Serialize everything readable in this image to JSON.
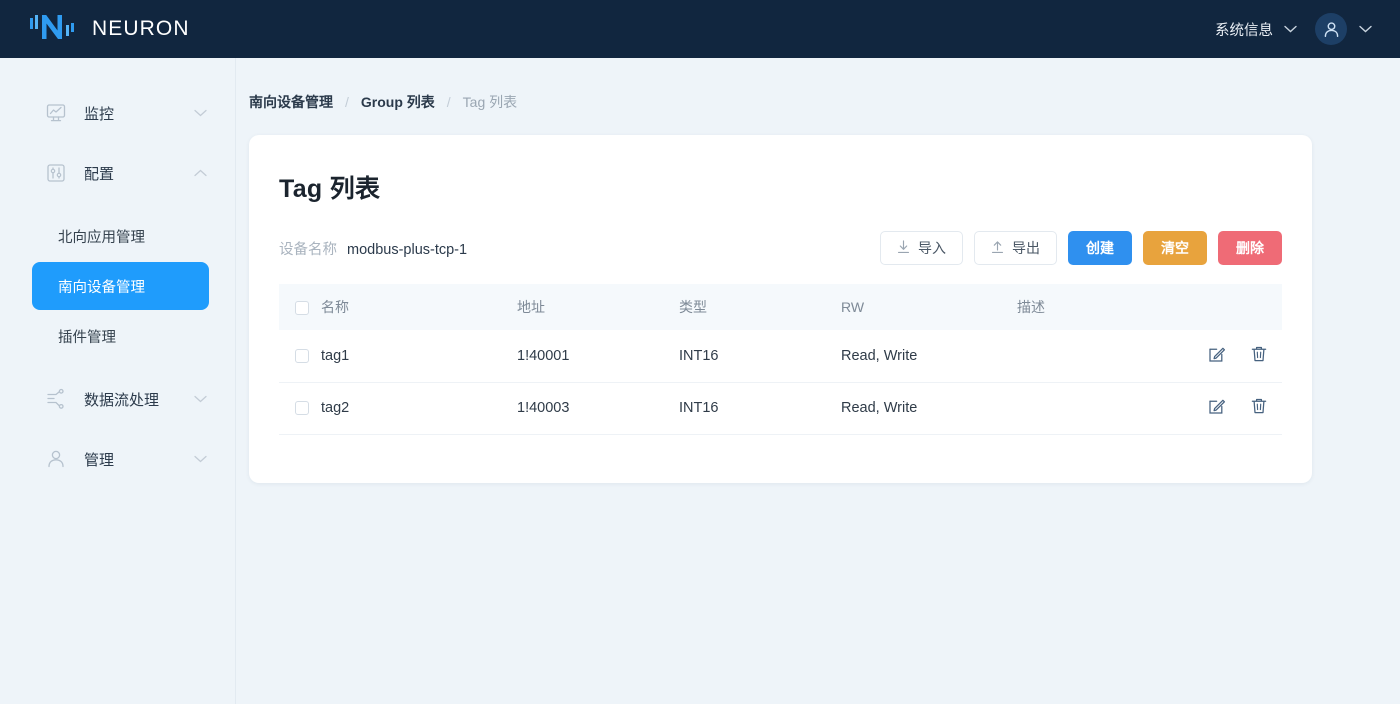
{
  "header": {
    "brand_name": "NEURON",
    "logo_icon": "neuron-logo-icon",
    "system_info_label": "系统信息",
    "system_info_chevron_icon": "chevron-down-icon",
    "avatar_icon": "user-avatar-icon",
    "avatar_chevron_icon": "chevron-down-icon",
    "brand_bg": "#11263f",
    "accent": "#2f90ef"
  },
  "sidebar": {
    "groups": [
      {
        "label": "监控",
        "icon": "monitor-chart-icon",
        "chevron_icon": "chevron-down-icon",
        "expanded": false
      },
      {
        "label": "配置",
        "icon": "sliders-config-icon",
        "chevron_icon": "chevron-up-icon",
        "expanded": true
      },
      {
        "label": "数据流处理",
        "icon": "data-flow-icon",
        "chevron_icon": "chevron-down-icon",
        "expanded": false
      },
      {
        "label": "管理",
        "icon": "user-manage-icon",
        "chevron_icon": "chevron-down-icon",
        "expanded": false
      }
    ],
    "config_children": [
      {
        "label": "北向应用管理",
        "active": false
      },
      {
        "label": "南向设备管理",
        "active": true
      },
      {
        "label": "插件管理",
        "active": false
      }
    ],
    "active_color": "#1f9cfc"
  },
  "breadcrumb": {
    "items": [
      {
        "label": "南向设备管理",
        "current": false
      },
      {
        "label": "Group 列表",
        "current": false
      },
      {
        "label": "Tag 列表",
        "current": true
      }
    ],
    "separator": "/"
  },
  "card": {
    "title": "Tag 列表",
    "device_label": "设备名称",
    "device_value": "modbus-plus-tcp-1",
    "buttons": [
      {
        "label": "导入",
        "style": "ghost",
        "icon": "download-import-icon"
      },
      {
        "label": "导出",
        "style": "ghost",
        "icon": "upload-export-icon"
      },
      {
        "label": "创建",
        "style": "primary",
        "icon": "",
        "color": "#2f90ef"
      },
      {
        "label": "清空",
        "style": "warn",
        "icon": "",
        "color": "#e8a33d"
      },
      {
        "label": "删除",
        "style": "danger",
        "icon": "",
        "color": "#ef6b76"
      }
    ]
  },
  "table": {
    "select_all_icon": "checkbox-icon",
    "columns": [
      "名称",
      "地址",
      "类型",
      "RW",
      "描述"
    ],
    "rows": [
      {
        "name": "tag1",
        "address": "1!40001",
        "type": "INT16",
        "rw": "Read, Write",
        "description": "",
        "edit_icon": "edit-pencil-icon",
        "delete_icon": "trash-icon"
      },
      {
        "name": "tag2",
        "address": "1!40003",
        "type": "INT16",
        "rw": "Read, Write",
        "description": "",
        "edit_icon": "edit-pencil-icon",
        "delete_icon": "trash-icon"
      }
    ]
  }
}
